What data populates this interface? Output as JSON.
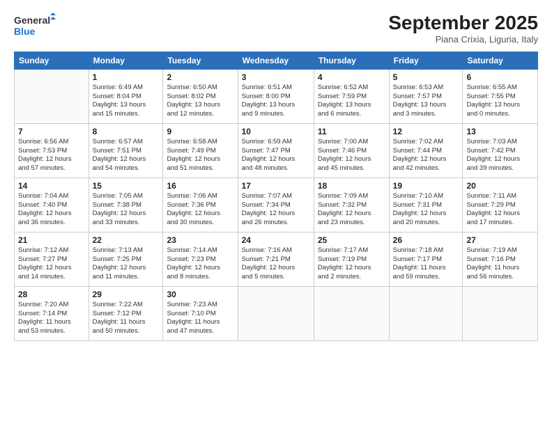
{
  "header": {
    "logo_line1": "General",
    "logo_line2": "Blue",
    "month": "September 2025",
    "location": "Piana Crixia, Liguria, Italy"
  },
  "days_of_week": [
    "Sunday",
    "Monday",
    "Tuesday",
    "Wednesday",
    "Thursday",
    "Friday",
    "Saturday"
  ],
  "weeks": [
    [
      {
        "day": "",
        "content": ""
      },
      {
        "day": "1",
        "content": "Sunrise: 6:49 AM\nSunset: 8:04 PM\nDaylight: 13 hours\nand 15 minutes."
      },
      {
        "day": "2",
        "content": "Sunrise: 6:50 AM\nSunset: 8:02 PM\nDaylight: 13 hours\nand 12 minutes."
      },
      {
        "day": "3",
        "content": "Sunrise: 6:51 AM\nSunset: 8:00 PM\nDaylight: 13 hours\nand 9 minutes."
      },
      {
        "day": "4",
        "content": "Sunrise: 6:52 AM\nSunset: 7:59 PM\nDaylight: 13 hours\nand 6 minutes."
      },
      {
        "day": "5",
        "content": "Sunrise: 6:53 AM\nSunset: 7:57 PM\nDaylight: 13 hours\nand 3 minutes."
      },
      {
        "day": "6",
        "content": "Sunrise: 6:55 AM\nSunset: 7:55 PM\nDaylight: 13 hours\nand 0 minutes."
      }
    ],
    [
      {
        "day": "7",
        "content": "Sunrise: 6:56 AM\nSunset: 7:53 PM\nDaylight: 12 hours\nand 57 minutes."
      },
      {
        "day": "8",
        "content": "Sunrise: 6:57 AM\nSunset: 7:51 PM\nDaylight: 12 hours\nand 54 minutes."
      },
      {
        "day": "9",
        "content": "Sunrise: 6:58 AM\nSunset: 7:49 PM\nDaylight: 12 hours\nand 51 minutes."
      },
      {
        "day": "10",
        "content": "Sunrise: 6:59 AM\nSunset: 7:47 PM\nDaylight: 12 hours\nand 48 minutes."
      },
      {
        "day": "11",
        "content": "Sunrise: 7:00 AM\nSunset: 7:46 PM\nDaylight: 12 hours\nand 45 minutes."
      },
      {
        "day": "12",
        "content": "Sunrise: 7:02 AM\nSunset: 7:44 PM\nDaylight: 12 hours\nand 42 minutes."
      },
      {
        "day": "13",
        "content": "Sunrise: 7:03 AM\nSunset: 7:42 PM\nDaylight: 12 hours\nand 39 minutes."
      }
    ],
    [
      {
        "day": "14",
        "content": "Sunrise: 7:04 AM\nSunset: 7:40 PM\nDaylight: 12 hours\nand 36 minutes."
      },
      {
        "day": "15",
        "content": "Sunrise: 7:05 AM\nSunset: 7:38 PM\nDaylight: 12 hours\nand 33 minutes."
      },
      {
        "day": "16",
        "content": "Sunrise: 7:06 AM\nSunset: 7:36 PM\nDaylight: 12 hours\nand 30 minutes."
      },
      {
        "day": "17",
        "content": "Sunrise: 7:07 AM\nSunset: 7:34 PM\nDaylight: 12 hours\nand 26 minutes."
      },
      {
        "day": "18",
        "content": "Sunrise: 7:09 AM\nSunset: 7:32 PM\nDaylight: 12 hours\nand 23 minutes."
      },
      {
        "day": "19",
        "content": "Sunrise: 7:10 AM\nSunset: 7:31 PM\nDaylight: 12 hours\nand 20 minutes."
      },
      {
        "day": "20",
        "content": "Sunrise: 7:11 AM\nSunset: 7:29 PM\nDaylight: 12 hours\nand 17 minutes."
      }
    ],
    [
      {
        "day": "21",
        "content": "Sunrise: 7:12 AM\nSunset: 7:27 PM\nDaylight: 12 hours\nand 14 minutes."
      },
      {
        "day": "22",
        "content": "Sunrise: 7:13 AM\nSunset: 7:25 PM\nDaylight: 12 hours\nand 11 minutes."
      },
      {
        "day": "23",
        "content": "Sunrise: 7:14 AM\nSunset: 7:23 PM\nDaylight: 12 hours\nand 8 minutes."
      },
      {
        "day": "24",
        "content": "Sunrise: 7:16 AM\nSunset: 7:21 PM\nDaylight: 12 hours\nand 5 minutes."
      },
      {
        "day": "25",
        "content": "Sunrise: 7:17 AM\nSunset: 7:19 PM\nDaylight: 12 hours\nand 2 minutes."
      },
      {
        "day": "26",
        "content": "Sunrise: 7:18 AM\nSunset: 7:17 PM\nDaylight: 11 hours\nand 59 minutes."
      },
      {
        "day": "27",
        "content": "Sunrise: 7:19 AM\nSunset: 7:16 PM\nDaylight: 11 hours\nand 56 minutes."
      }
    ],
    [
      {
        "day": "28",
        "content": "Sunrise: 7:20 AM\nSunset: 7:14 PM\nDaylight: 11 hours\nand 53 minutes."
      },
      {
        "day": "29",
        "content": "Sunrise: 7:22 AM\nSunset: 7:12 PM\nDaylight: 11 hours\nand 50 minutes."
      },
      {
        "day": "30",
        "content": "Sunrise: 7:23 AM\nSunset: 7:10 PM\nDaylight: 11 hours\nand 47 minutes."
      },
      {
        "day": "",
        "content": ""
      },
      {
        "day": "",
        "content": ""
      },
      {
        "day": "",
        "content": ""
      },
      {
        "day": "",
        "content": ""
      }
    ]
  ]
}
